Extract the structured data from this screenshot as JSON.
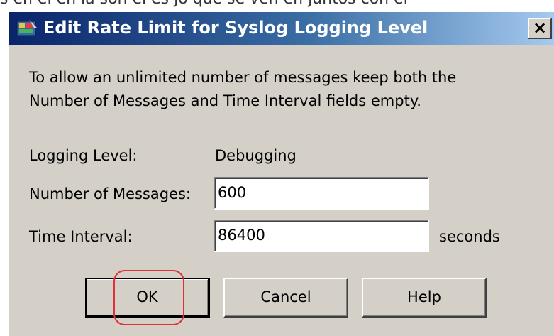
{
  "background_text": "s en el en la son el es jo que se ven en juntos con el",
  "dialog": {
    "title": "Edit Rate Limit for Syslog Logging Level",
    "app_icon": "asdm-app-icon",
    "close_glyph": "×",
    "info_line1": "To allow an unlimited number of messages keep both the",
    "info_line2": "Number of Messages and Time Interval fields empty."
  },
  "form": {
    "logging_level_label": "Logging Level:",
    "logging_level_value": "Debugging",
    "num_messages_label": "Number of Messages:",
    "num_messages_value": "600",
    "time_interval_label": "Time Interval:",
    "time_interval_value": "86400",
    "time_interval_unit": "seconds"
  },
  "buttons": {
    "ok": "OK",
    "cancel": "Cancel",
    "help": "Help"
  },
  "colors": {
    "titlebar_start": "#0a246a",
    "titlebar_end": "#a6caf0",
    "dialog_face": "#d4d0c8",
    "highlight_ring": "#e0303a"
  }
}
